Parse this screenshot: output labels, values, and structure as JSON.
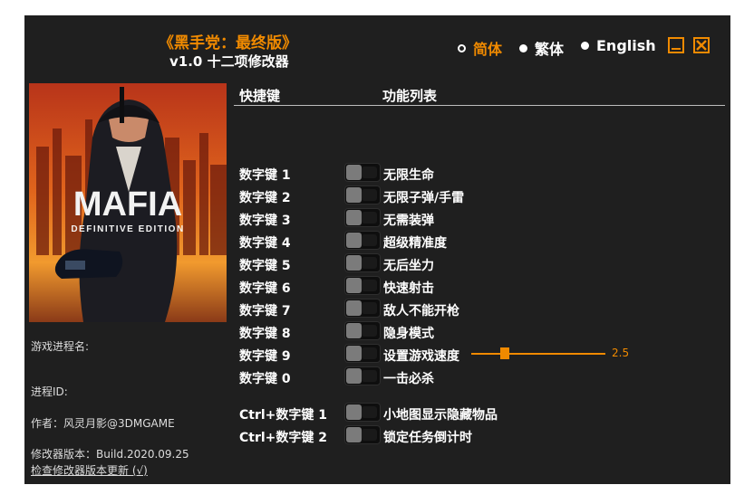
{
  "title": {
    "game": "《黑手党：最终版》",
    "trainer": "v1.0 十二项修改器"
  },
  "languages": [
    {
      "label": "简体",
      "selected": true
    },
    {
      "label": "繁体",
      "selected": false
    },
    {
      "label": "English",
      "selected": false
    }
  ],
  "cover": {
    "logo": "MAFIA",
    "subtitle": "DEFINITIVE EDITION"
  },
  "info": {
    "process_name": "游戏进程名:",
    "process_id": "进程ID:",
    "author": "作者：风灵月影@3DMGAME",
    "version": "修改器版本：Build.2020.09.25",
    "update_link": "检查修改器版本更新 (√)"
  },
  "headers": {
    "hotkey": "快捷键",
    "function": "功能列表"
  },
  "cheats": [
    {
      "key": "数字键 1",
      "name": "无限生命",
      "on": false
    },
    {
      "key": "数字键 2",
      "name": "无限子弹/手雷",
      "on": false
    },
    {
      "key": "数字键 3",
      "name": "无需装弹",
      "on": false
    },
    {
      "key": "数字键 4",
      "name": "超级精准度",
      "on": false
    },
    {
      "key": "数字键 5",
      "name": "无后坐力",
      "on": false
    },
    {
      "key": "数字键 6",
      "name": "快速射击",
      "on": false
    },
    {
      "key": "数字键 7",
      "name": "敌人不能开枪",
      "on": false
    },
    {
      "key": "数字键 8",
      "name": "隐身模式",
      "on": false
    },
    {
      "key": "数字键 9",
      "name": "设置游戏速度",
      "on": false
    },
    {
      "key": "数字键 0",
      "name": "一击必杀",
      "on": false
    },
    {
      "key": "Ctrl+数字键 1",
      "name": "小地图显示隐藏物品",
      "on": false
    },
    {
      "key": "Ctrl+数字键 2",
      "name": "锁定任务倒计时",
      "on": false
    }
  ],
  "speed_slider": {
    "value": "2.5",
    "fraction": 0.25
  },
  "colors": {
    "accent": "#f08a00",
    "background": "#1f1f1f"
  },
  "icons": {
    "minimize": "minimize-icon",
    "close": "close-icon"
  }
}
